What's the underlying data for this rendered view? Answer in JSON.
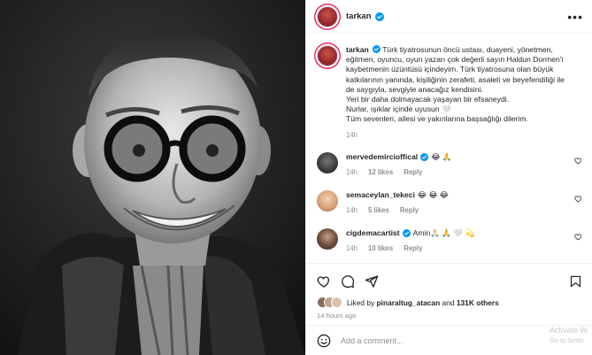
{
  "post": {
    "username": "tarkan"
  },
  "caption": {
    "username": "tarkan",
    "lines": [
      "Türk tiyatrosunun öncü ustası, duayeni, yönetmen,",
      "eğitmen, oyuncu, oyun yazarı çok değerli sayın Haldun Dormen'i",
      "kaybetmenin üzüntüsü içindeyim. Türk tiyatrosuna olan büyük",
      "katkılarının yanında, kişiliğinin zerafeti, asaleti ve beyefendiliği ile",
      "de saygıyla, sevgiyle anacağız kendisini.",
      "Yeri bir daha dolmayacak yaşayan bir efsaneydi.",
      "Nurlar, ışıklar içinde uyusun 🤍",
      "Tüm sevenleri, ailesi ve yakınlarına başsağlığı dilerim."
    ],
    "time": "14h"
  },
  "comments": [
    {
      "username": "merveddemircioffical",
      "display_username": "mervedemircioffical",
      "text": "😂 🙏",
      "time": "14h",
      "likes": "12 likes",
      "reply": "Reply",
      "avatar_color": "#3a3a3a"
    },
    {
      "username": "semaceylan_tekeci",
      "display_username": "semaceylan_tekeci",
      "text": "😂 😂 😂",
      "time": "14h",
      "likes": "5 likes",
      "reply": "Reply",
      "avatar_color": "#d9a27a"
    },
    {
      "username": "cigdemacartist",
      "display_username": "cigdemacartist",
      "text": "Amin🙏🏻 🙏 🤍 💫",
      "time": "14h",
      "likes": "10 likes",
      "reply": "Reply",
      "avatar_color": "#6b4a3c"
    }
  ],
  "actions": {
    "liked_by_prefix": "Liked by",
    "liked_by_user": "pinaraltug_atacan",
    "liked_by_conj": "and",
    "liked_by_count": "131K others",
    "time": "14 hours ago"
  },
  "add_comment": {
    "placeholder": "Add a comment..."
  },
  "watermark": {
    "line1": "Activate W",
    "line2": "Go to Settin"
  },
  "colors": {
    "verified": "#0095f6",
    "muted": "#8e8e8e",
    "text": "#262626",
    "border": "#efefef"
  }
}
